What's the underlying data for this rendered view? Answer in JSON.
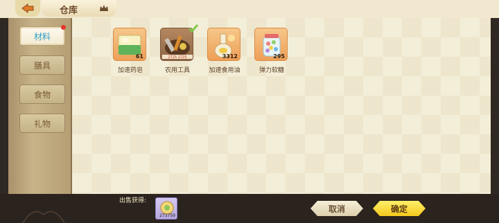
{
  "header": {
    "title": "仓库"
  },
  "sidebar": {
    "items": [
      {
        "label": "材料",
        "active": true
      },
      {
        "label": "膳具",
        "active": false
      },
      {
        "label": "食物",
        "active": false
      },
      {
        "label": "礼物",
        "active": false
      }
    ]
  },
  "inventory": {
    "items": [
      {
        "label": "加速药皂",
        "count": "61",
        "icon": "soap-icon"
      },
      {
        "label": "农用工具",
        "count": "",
        "icon": "tools-icon"
      },
      {
        "label": "加速食用油",
        "count": "3312",
        "icon": "oil-icon"
      },
      {
        "label": "弹力软糖",
        "count": "295",
        "icon": "candy-jar-icon"
      }
    ]
  },
  "footer": {
    "sell_label": "出售获得:",
    "sell_count": "273759",
    "cancel_label": "取消",
    "ok_label": "确定"
  },
  "colors": {
    "accent": "#2e9fc5",
    "confirm": "#f5c81c",
    "badge": "#e5382c"
  }
}
